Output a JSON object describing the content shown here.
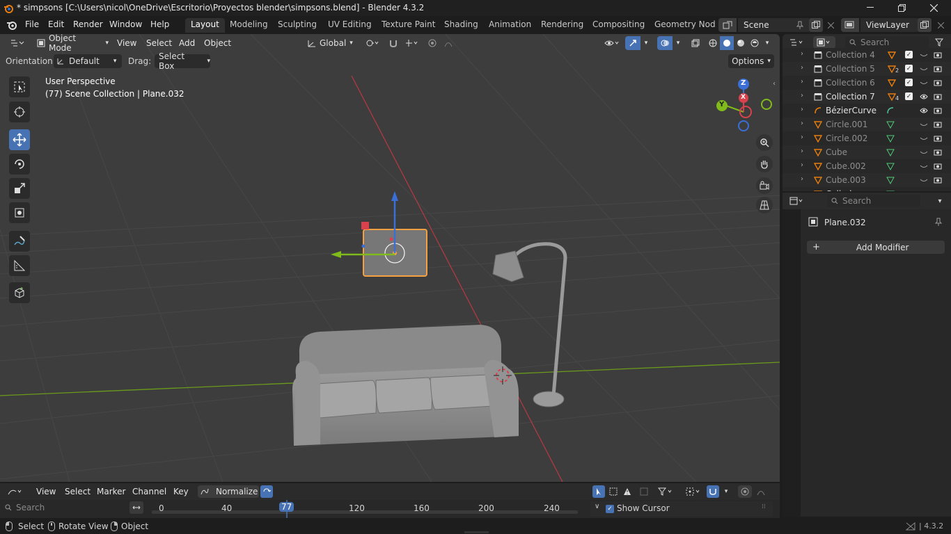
{
  "window": {
    "title": "* simpsons [C:\\Users\\nicol\\OneDrive\\Escritorio\\Proyectos blender\\simpsons.blend] - Blender 4.3.2"
  },
  "menu": [
    "File",
    "Edit",
    "Render",
    "Window",
    "Help"
  ],
  "workspaces": [
    "Layout",
    "Modeling",
    "Sculpting",
    "UV Editing",
    "Texture Paint",
    "Shading",
    "Animation",
    "Rendering",
    "Compositing",
    "Geometry Node"
  ],
  "scene": {
    "name": "Scene",
    "view_layer": "ViewLayer"
  },
  "viewport_header": {
    "mode": "Object Mode",
    "menus": [
      "View",
      "Select",
      "Add",
      "Object"
    ],
    "transform_orientation": "Global"
  },
  "tool_settings": {
    "orientation_label": "Orientation:",
    "orientation_value": "Default",
    "drag_label": "Drag:",
    "drag_value": "Select Box",
    "options": "Options"
  },
  "overlay": {
    "perspective": "User Perspective",
    "object_info": "(77) Scene Collection | Plane.032"
  },
  "gizmo": {
    "z": "Z",
    "x": "X",
    "y": "Y"
  },
  "outliner": {
    "search_placeholder": "Search",
    "rows": [
      {
        "label": "Collection 4",
        "dim": true
      },
      {
        "label": "Collection 5",
        "badge": "2",
        "dim": true
      },
      {
        "label": "Collection 6",
        "dim": true
      },
      {
        "label": "Collection 7",
        "badge": "4",
        "dim": false
      },
      {
        "label": "BézierCurve",
        "dim": false
      },
      {
        "label": "Circle.001",
        "dim": true
      },
      {
        "label": "Circle.002",
        "dim": true
      },
      {
        "label": "Cube",
        "dim": true
      },
      {
        "label": "Cube.002",
        "dim": true
      },
      {
        "label": "Cube.003",
        "dim": true
      },
      {
        "label": "Cylinder",
        "dim": false
      }
    ]
  },
  "properties": {
    "search_placeholder": "Search",
    "object": "Plane.032",
    "add_modifier": "Add Modifier"
  },
  "timeline": {
    "menus": [
      "View",
      "Select",
      "Marker",
      "Channel",
      "Key"
    ],
    "normalize": "Normalize",
    "search_placeholder": "Search",
    "ticks": [
      "0",
      "40",
      "120",
      "160",
      "200",
      "240"
    ],
    "current_frame": "77",
    "show_cursor": "Show Cursor"
  },
  "statusbar": {
    "items": [
      "Select",
      "Rotate View",
      "Object"
    ],
    "version": "4.3.2"
  },
  "colors": {
    "accent": "#4772b3",
    "selection": "#f5a142",
    "x_axis": "#d9424d",
    "y_axis": "#80bb1b",
    "z_axis": "#3b6fd6"
  }
}
